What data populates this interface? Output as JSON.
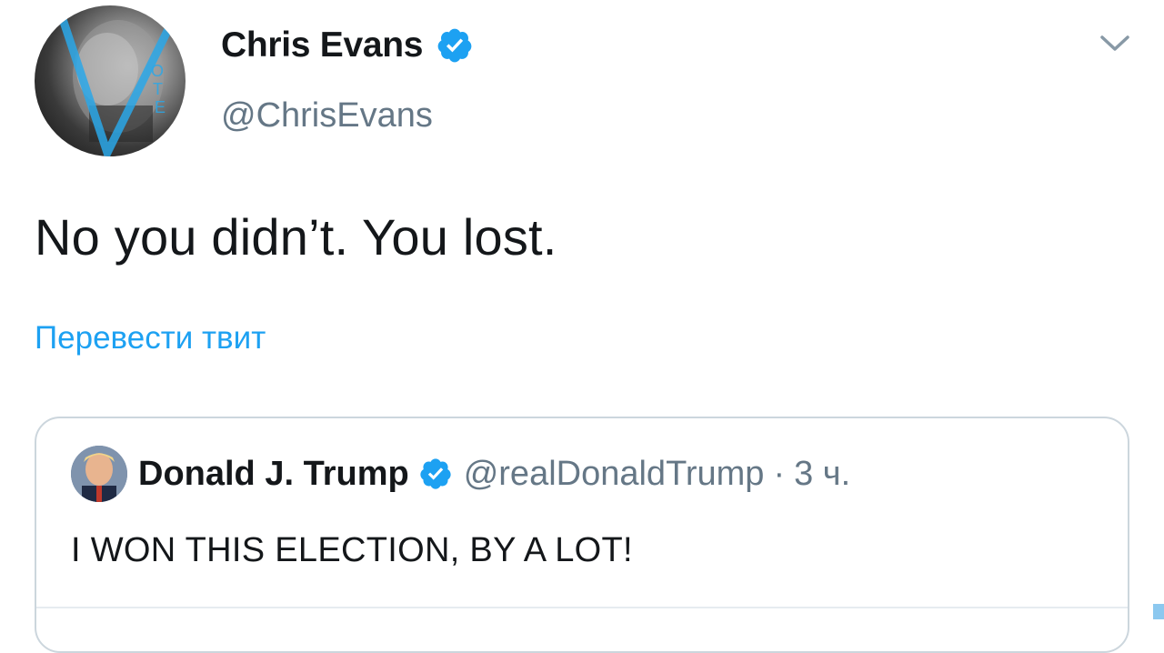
{
  "tweet": {
    "author": {
      "name": "Chris Evans",
      "handle": "@ChrisEvans",
      "verified": true,
      "avatar_icon": "avatar-photo"
    },
    "text": "No you didn’t. You lost.",
    "translate_label": "Перевести твит",
    "menu_icon": "chevron-down-icon",
    "quoted": {
      "name": "Donald J. Trump",
      "handle": "@realDonaldTrump",
      "separator": "·",
      "time": "3 ч.",
      "verified": true,
      "text": "I WON THIS ELECTION, BY A LOT!"
    }
  },
  "colors": {
    "accent": "#1da1f2",
    "text_primary": "#14171a",
    "text_secondary": "#657786",
    "border": "#ccd6dd"
  }
}
